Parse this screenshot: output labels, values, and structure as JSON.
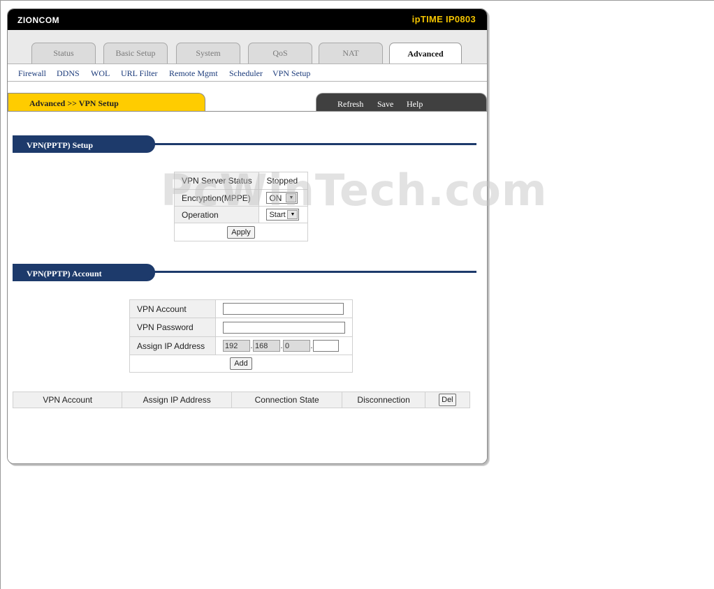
{
  "header": {
    "brand": "ZIONCOM",
    "model": "ipTIME IP0803"
  },
  "tabs": [
    {
      "label": "Status"
    },
    {
      "label": "Basic Setup"
    },
    {
      "label": "System"
    },
    {
      "label": "QoS"
    },
    {
      "label": "NAT"
    },
    {
      "label": "Advanced",
      "active": true
    }
  ],
  "subnav": [
    "Firewall",
    "DDNS",
    "WOL",
    "URL Filter",
    "Remote Mgmt",
    "Scheduler",
    "VPN Setup"
  ],
  "breadcrumb": "Advanced >> VPN Setup",
  "actions": {
    "refresh": "Refresh",
    "save": "Save",
    "help": "Help"
  },
  "watermark": "PcWinTech.com",
  "vpn_setup": {
    "title": "VPN(PPTP) Setup",
    "server_status_label": "VPN Server Status",
    "server_status_value": "Stopped",
    "encryption_label": "Encryption(MPPE)",
    "encryption_value": "ON",
    "operation_label": "Operation",
    "operation_value": "Start",
    "apply_label": "Apply"
  },
  "vpn_account": {
    "title": "VPN(PPTP) Account",
    "account_label": "VPN Account",
    "account_value": "",
    "password_label": "VPN Password",
    "password_value": "",
    "ip_label": "Assign IP Address",
    "ip_octets": [
      "192",
      "168",
      "0",
      ""
    ],
    "add_label": "Add"
  },
  "account_table": {
    "columns": [
      "VPN Account",
      "Assign IP Address",
      "Connection State",
      "Disconnection"
    ],
    "delete_label": "Del"
  },
  "colors": {
    "accent_yellow": "#ffcc00",
    "section_navy": "#1d3a6b",
    "model_gold": "#f2c300"
  }
}
